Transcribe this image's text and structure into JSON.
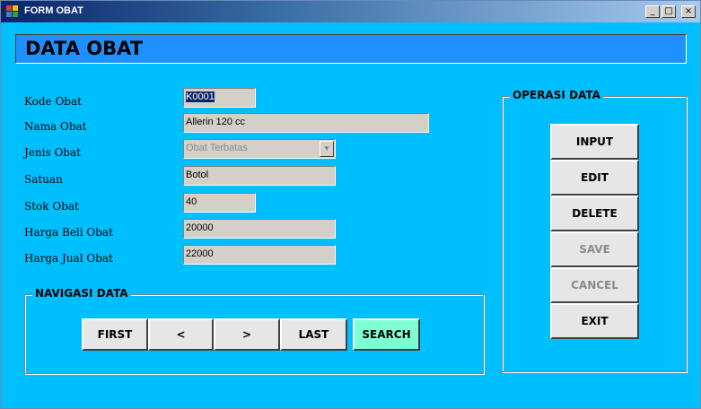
{
  "window": {
    "title": "FORM OBAT",
    "controls": {
      "minimize": "_",
      "maximize": "□",
      "close": "×"
    }
  },
  "header": {
    "title": "DATA OBAT"
  },
  "form": {
    "kode": {
      "label": "Kode Obat",
      "value": "K0001"
    },
    "nama": {
      "label": "Nama Obat",
      "value": "Allerin 120 cc"
    },
    "jenis": {
      "label": "Jenis Obat",
      "value": "Obat Terbatas",
      "arrow": "▼"
    },
    "satuan": {
      "label": "Satuan",
      "value": "Botol"
    },
    "stok": {
      "label": "Stok Obat",
      "value": "40"
    },
    "harga_beli": {
      "label": "Harga Beli Obat",
      "value": "20000"
    },
    "harga_jual": {
      "label": "Harga Jual Obat",
      "value": "22000"
    }
  },
  "navigasi": {
    "title": "NAVIGASI DATA",
    "first": "FIRST",
    "prev": "<",
    "next": ">",
    "last": "LAST",
    "search": "SEARCH"
  },
  "operasi": {
    "title": "OPERASI DATA",
    "input": "INPUT",
    "edit": "EDIT",
    "delete": "DELETE",
    "save": "SAVE",
    "cancel": "CANCEL",
    "exit": "EXIT"
  },
  "colors": {
    "form_bg": "#00BFFF",
    "header_bg": "#1E90FF",
    "search_bg": "#7FFFD4",
    "button_bg": "#E6E6E6",
    "field_bg": "#D4D0C8"
  }
}
